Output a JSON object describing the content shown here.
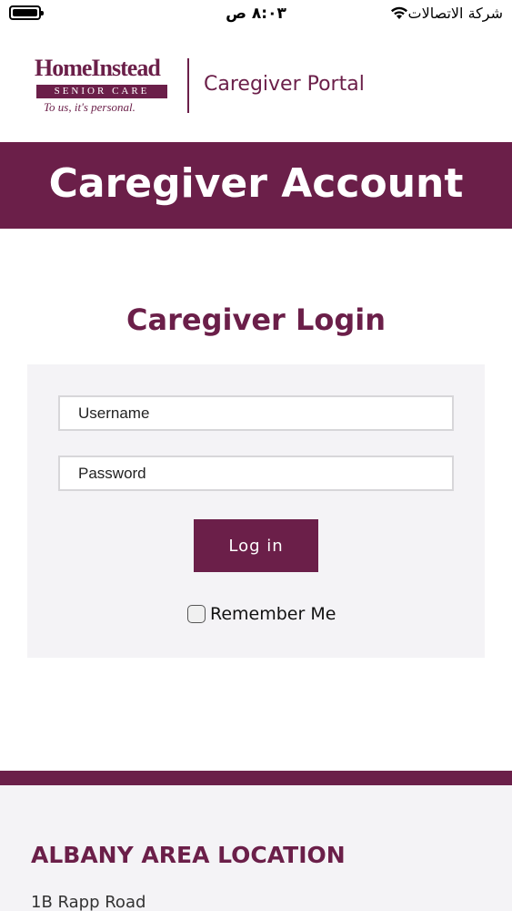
{
  "status_bar": {
    "time": "٨:٠٣ ص",
    "carrier": "شركة الاتصالات",
    "icons": [
      "battery-icon",
      "wifi-icon"
    ]
  },
  "header": {
    "logo": {
      "name_line": "HomeInstead",
      "sub_line": "SENIOR CARE",
      "tagline": "To us, it's personal."
    },
    "portal_title": "Caregiver Portal"
  },
  "banner": {
    "title": "Caregiver Account"
  },
  "login": {
    "heading": "Caregiver Login",
    "username_placeholder": "Username",
    "password_placeholder": "Password",
    "button_label": "Log in",
    "remember_label": "Remember Me"
  },
  "footer": {
    "location_title": "ALBANY AREA LOCATION",
    "address_line1": "1B Rapp Road"
  },
  "colors": {
    "brand": "#6b1f49",
    "panel_bg": "#f4f3f6"
  }
}
